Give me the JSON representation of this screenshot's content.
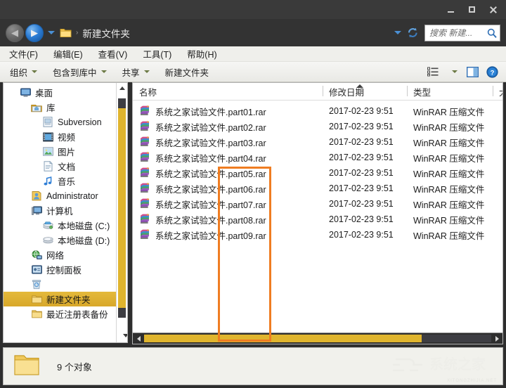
{
  "window": {
    "title": "新建文件夹",
    "buttons": {
      "minimize": "minimize",
      "maximize": "maximize",
      "close": "close"
    }
  },
  "address": {
    "breadcrumb": "新建文件夹",
    "separator": "›",
    "back_glyph": "◀",
    "forward_glyph": "▶"
  },
  "search": {
    "placeholder": "搜索 新建...",
    "value": ""
  },
  "menubar": {
    "items": [
      {
        "label": "文件(F)"
      },
      {
        "label": "编辑(E)"
      },
      {
        "label": "查看(V)"
      },
      {
        "label": "工具(T)"
      },
      {
        "label": "帮助(H)"
      }
    ]
  },
  "toolbar": {
    "items": [
      {
        "label": "组织",
        "has_caret": true
      },
      {
        "label": "包含到库中",
        "has_caret": true
      },
      {
        "label": "共享",
        "has_caret": true
      },
      {
        "label": "新建文件夹",
        "has_caret": false
      }
    ],
    "right_icons": [
      {
        "name": "view-options-icon"
      },
      {
        "name": "view-options-caret-icon"
      },
      {
        "name": "preview-pane-icon"
      },
      {
        "name": "help-icon"
      }
    ]
  },
  "sidebar": {
    "items": [
      {
        "label": "桌面",
        "icon": "desktop-icon",
        "level": 0,
        "selected": false
      },
      {
        "label": "库",
        "icon": "library-icon",
        "level": 1,
        "selected": false
      },
      {
        "label": "Subversion",
        "icon": "subversion-icon",
        "level": 2,
        "selected": false
      },
      {
        "label": "视频",
        "icon": "video-icon",
        "level": 2,
        "selected": false
      },
      {
        "label": "图片",
        "icon": "pictures-icon",
        "level": 2,
        "selected": false
      },
      {
        "label": "文档",
        "icon": "documents-icon",
        "level": 2,
        "selected": false
      },
      {
        "label": "音乐",
        "icon": "music-icon",
        "level": 2,
        "selected": false
      },
      {
        "label": "Administrator",
        "icon": "user-icon",
        "level": 1,
        "selected": false
      },
      {
        "label": "计算机",
        "icon": "computer-icon",
        "level": 1,
        "selected": false
      },
      {
        "label": "本地磁盘 (C:)",
        "icon": "system-drive-icon",
        "level": 2,
        "selected": false
      },
      {
        "label": "本地磁盘 (D:)",
        "icon": "drive-icon",
        "level": 2,
        "selected": false
      },
      {
        "label": "网络",
        "icon": "network-icon",
        "level": 1,
        "selected": false
      },
      {
        "label": "控制面板",
        "icon": "control-panel-icon",
        "level": 1,
        "selected": false
      },
      {
        "label": "",
        "icon": "recycle-bin-icon",
        "level": 1,
        "selected": false
      },
      {
        "label": "新建文件夹",
        "icon": "folder-icon",
        "level": 1,
        "selected": true
      },
      {
        "label": "最近注册表备份",
        "icon": "folder-icon",
        "level": 1,
        "selected": false
      }
    ]
  },
  "filelist": {
    "columns": [
      {
        "key": "name",
        "label": "名称"
      },
      {
        "key": "date",
        "label": "修改日期"
      },
      {
        "key": "type",
        "label": "类型"
      },
      {
        "key": "size",
        "label": "大"
      }
    ],
    "rows": [
      {
        "name": "系统之家试验文件.part01.rar",
        "date": "2017-02-23 9:51",
        "type": "WinRAR 压缩文件",
        "size": ""
      },
      {
        "name": "系统之家试验文件.part02.rar",
        "date": "2017-02-23 9:51",
        "type": "WinRAR 压缩文件",
        "size": ""
      },
      {
        "name": "系统之家试验文件.part03.rar",
        "date": "2017-02-23 9:51",
        "type": "WinRAR 压缩文件",
        "size": ""
      },
      {
        "name": "系统之家试验文件.part04.rar",
        "date": "2017-02-23 9:51",
        "type": "WinRAR 压缩文件",
        "size": ""
      },
      {
        "name": "系统之家试验文件.part05.rar",
        "date": "2017-02-23 9:51",
        "type": "WinRAR 压缩文件",
        "size": ""
      },
      {
        "name": "系统之家试验文件.part06.rar",
        "date": "2017-02-23 9:51",
        "type": "WinRAR 压缩文件",
        "size": ""
      },
      {
        "name": "系统之家试验文件.part07.rar",
        "date": "2017-02-23 9:51",
        "type": "WinRAR 压缩文件",
        "size": ""
      },
      {
        "name": "系统之家试验文件.part08.rar",
        "date": "2017-02-23 9:51",
        "type": "WinRAR 压缩文件",
        "size": ""
      },
      {
        "name": "系统之家试验文件.part09.rar",
        "date": "2017-02-23 9:51",
        "type": "WinRAR 压缩文件",
        "size": ""
      }
    ]
  },
  "statusbar": {
    "text": "9 个对象",
    "watermark": "系统之家",
    "watermark_sub": "XITONGZHIJIA.NET"
  },
  "colors": {
    "titlebar": "#3a3a3a",
    "addressbar": "#333333",
    "menubar": "#efefeb",
    "selection_gold": "#e4b93b",
    "scrollbar_thumb": "#e0b52e",
    "annotation_orange": "#ef7d22",
    "pane_background": "#ffffff",
    "window_frame": "#2e2e2e"
  },
  "annotation": {
    "name": "orange-highlight-rectangle",
    "color": "#ef7d22"
  }
}
